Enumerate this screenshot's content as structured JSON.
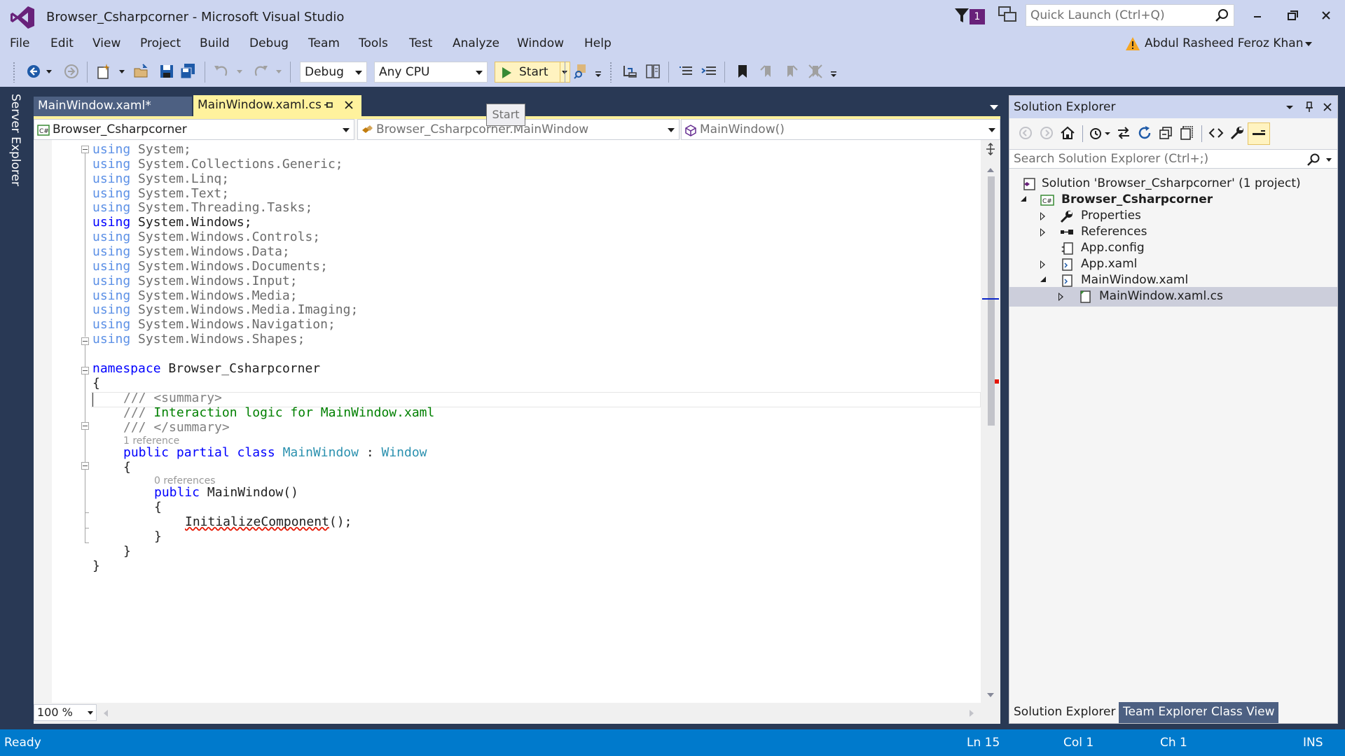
{
  "title_bar": {
    "window_title": "Browser_Csharpcorner - Microsoft Visual Studio",
    "notification_count": "1",
    "quick_launch_placeholder": "Quick Launch (Ctrl+Q)"
  },
  "menu": {
    "items": [
      "File",
      "Edit",
      "View",
      "Project",
      "Build",
      "Debug",
      "Team",
      "Tools",
      "Test",
      "Analyze",
      "Window",
      "Help"
    ],
    "account_name": "Abdul Rasheed Feroz Khan"
  },
  "toolbar": {
    "configuration": "Debug",
    "platform": "Any CPU",
    "start_label": "Start",
    "tooltip": "Start"
  },
  "side_tabs": {
    "server_explorer": "Server Explorer"
  },
  "document_tabs": [
    {
      "label": "MainWindow.xaml*",
      "active": false
    },
    {
      "label": "MainWindow.xaml.cs",
      "active": true
    }
  ],
  "navigation_bar": {
    "project": "Browser_Csharpcorner",
    "type": "Browser_Csharpcorner.MainWindow",
    "member": "MainWindow()"
  },
  "editor": {
    "usings": [
      {
        "kw": "using",
        "ns": "System;",
        "active": false
      },
      {
        "kw": "using",
        "ns": "System.Collections.Generic;",
        "active": false
      },
      {
        "kw": "using",
        "ns": "System.Linq;",
        "active": false
      },
      {
        "kw": "using",
        "ns": "System.Text;",
        "active": false
      },
      {
        "kw": "using",
        "ns": "System.Threading.Tasks;",
        "active": false
      },
      {
        "kw": "using",
        "ns": "System.Windows;",
        "active": true
      },
      {
        "kw": "using",
        "ns": "System.Windows.Controls;",
        "active": false
      },
      {
        "kw": "using",
        "ns": "System.Windows.Data;",
        "active": false
      },
      {
        "kw": "using",
        "ns": "System.Windows.Documents;",
        "active": false
      },
      {
        "kw": "using",
        "ns": "System.Windows.Input;",
        "active": false
      },
      {
        "kw": "using",
        "ns": "System.Windows.Media;",
        "active": false
      },
      {
        "kw": "using",
        "ns": "System.Windows.Media.Imaging;",
        "active": false
      },
      {
        "kw": "using",
        "ns": "System.Windows.Navigation;",
        "active": false
      },
      {
        "kw": "using",
        "ns": "System.Windows.Shapes;",
        "active": false
      }
    ],
    "namespace_kw": "namespace",
    "namespace_name": "Browser_Csharpcorner",
    "open_brace": "{",
    "close_brace": "}",
    "summary_open": "/// <summary>",
    "summary_text_prefix": "/// ",
    "summary_text": "Interaction logic for MainWindow.xaml",
    "summary_close": "/// </summary>",
    "class_lens": "1 reference",
    "class_kw": "public partial class",
    "class_name": "MainWindow",
    "class_colon": ":",
    "class_base": "Window",
    "ctor_lens": "0 references",
    "ctor_kw": "public",
    "ctor_sig": "MainWindow()",
    "ctor_body": "InitializeComponent",
    "ctor_body_end": "();",
    "zoom": "100 %"
  },
  "solution_explorer": {
    "title": "Solution Explorer",
    "search_placeholder": "Search Solution Explorer (Ctrl+;)",
    "solution": "Solution 'Browser_Csharpcorner' (1 project)",
    "project": "Browser_Csharpcorner",
    "items": [
      "Properties",
      "References",
      "App.config",
      "App.xaml",
      "MainWindow.xaml",
      "MainWindow.xaml.cs"
    ],
    "bottom_tabs": [
      "Solution Explorer",
      "Team Explorer",
      "Class View"
    ]
  },
  "status_bar": {
    "state": "Ready",
    "line": "Ln 15",
    "col": "Col 1",
    "ch": "Ch 1",
    "mode": "INS"
  },
  "colors": {
    "accent": "#007acc",
    "vs_purple": "#68217a",
    "active_tab": "#fff29d",
    "background": "#293955",
    "keyword": "#0000ff",
    "type": "#2b91af",
    "comment": "#008000"
  }
}
